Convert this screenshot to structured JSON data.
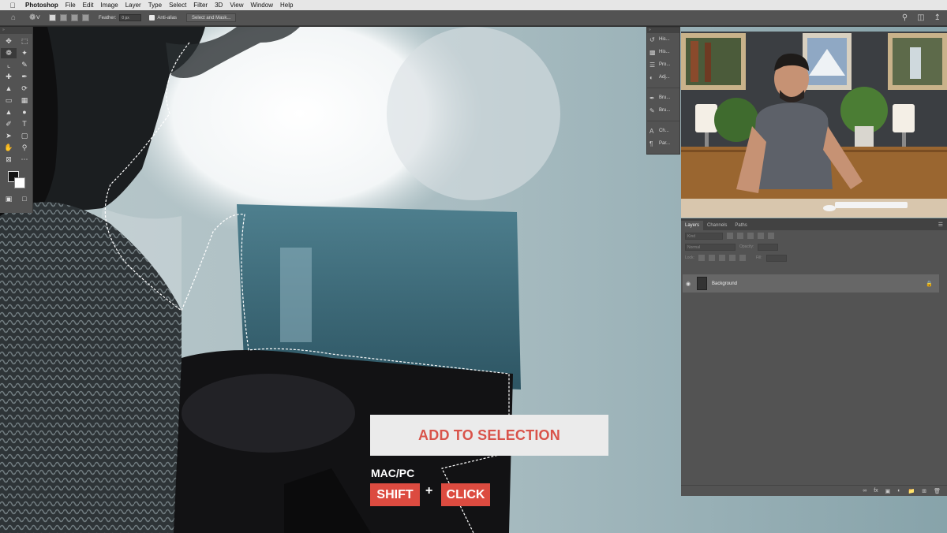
{
  "menubar": {
    "app_name": "Photoshop",
    "items": [
      "File",
      "Edit",
      "Image",
      "Layer",
      "Type",
      "Select",
      "Filter",
      "3D",
      "View",
      "Window",
      "Help"
    ]
  },
  "options_bar": {
    "feather_label": "Feather:",
    "feather_value": "0 px",
    "antialias_label": "Anti-alias",
    "antialias_checked": true,
    "select_mask_label": "Select and Mask..."
  },
  "dock": {
    "items": [
      {
        "label": "His...",
        "icon": "history-icon"
      },
      {
        "label": "His...",
        "icon": "histogram-icon"
      },
      {
        "label": "Pro...",
        "icon": "properties-icon"
      },
      {
        "label": "Adj...",
        "icon": "adjustments-icon"
      },
      {
        "label": "Bru...",
        "icon": "brush-icon"
      },
      {
        "label": "Bru...",
        "icon": "brush-settings-icon"
      },
      {
        "label": "Ch...",
        "icon": "character-icon"
      },
      {
        "label": "Par...",
        "icon": "paragraph-icon"
      }
    ]
  },
  "layers_panel": {
    "tabs": [
      "Layers",
      "Channels",
      "Paths"
    ],
    "active_tab": "Layers",
    "filter_placeholder": "Kind",
    "blend_mode": "Normal",
    "opacity_label": "Opacity:",
    "lock_label": "Lock:",
    "fill_label": "Fill:",
    "layers": [
      {
        "name": "Background",
        "visible": true,
        "locked": true
      }
    ]
  },
  "overlay": {
    "title": "ADD TO SELECTION",
    "platform": "MAC/PC",
    "key1": "SHIFT",
    "plus": "+",
    "key2": "CLICK"
  },
  "colors": {
    "accent_red": "#dc4b40",
    "title_red": "#d9534a",
    "panel_bg": "#535353"
  }
}
